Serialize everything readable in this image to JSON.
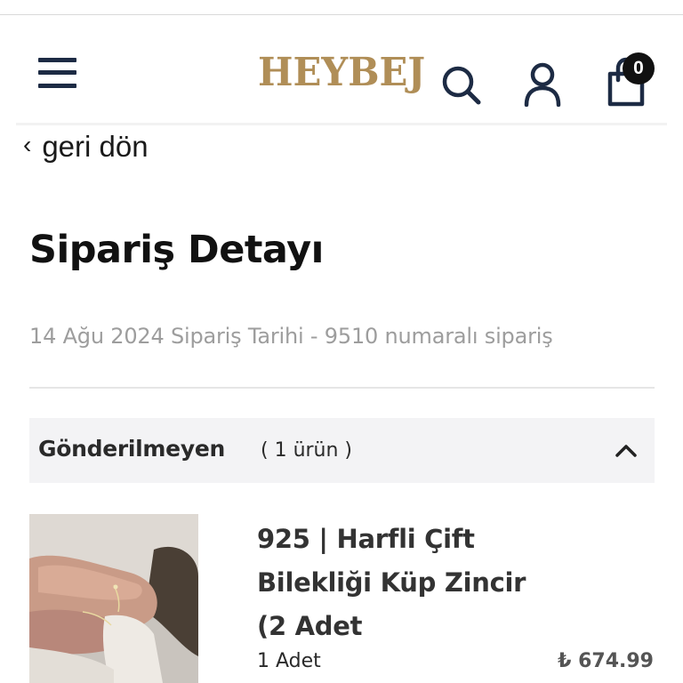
{
  "header": {
    "logo_text": "HEYBEJ",
    "cart_count": "0",
    "icons": [
      "menu-icon",
      "search-icon",
      "user-icon",
      "shopping-bag-icon"
    ],
    "brand_color": "#b08e57",
    "icon_color": "#1d2b44"
  },
  "nav": {
    "back_chevron": "‹",
    "back_label": "geri dön"
  },
  "order": {
    "title": "Sipariş Detayı",
    "meta": "14 Ağu 2024 Sipariş Tarihi - 9510 numaralı sipariş"
  },
  "group": {
    "label": "Gönderilmeyen",
    "count": "( 1 ürün )",
    "expanded": true
  },
  "item": {
    "name": "925 | Harfli Çift Bilekliği Küp Zincir (2 Adet",
    "quantity": "1 Adet",
    "price": "₺ 674.99",
    "image_icon": "product-photo"
  }
}
